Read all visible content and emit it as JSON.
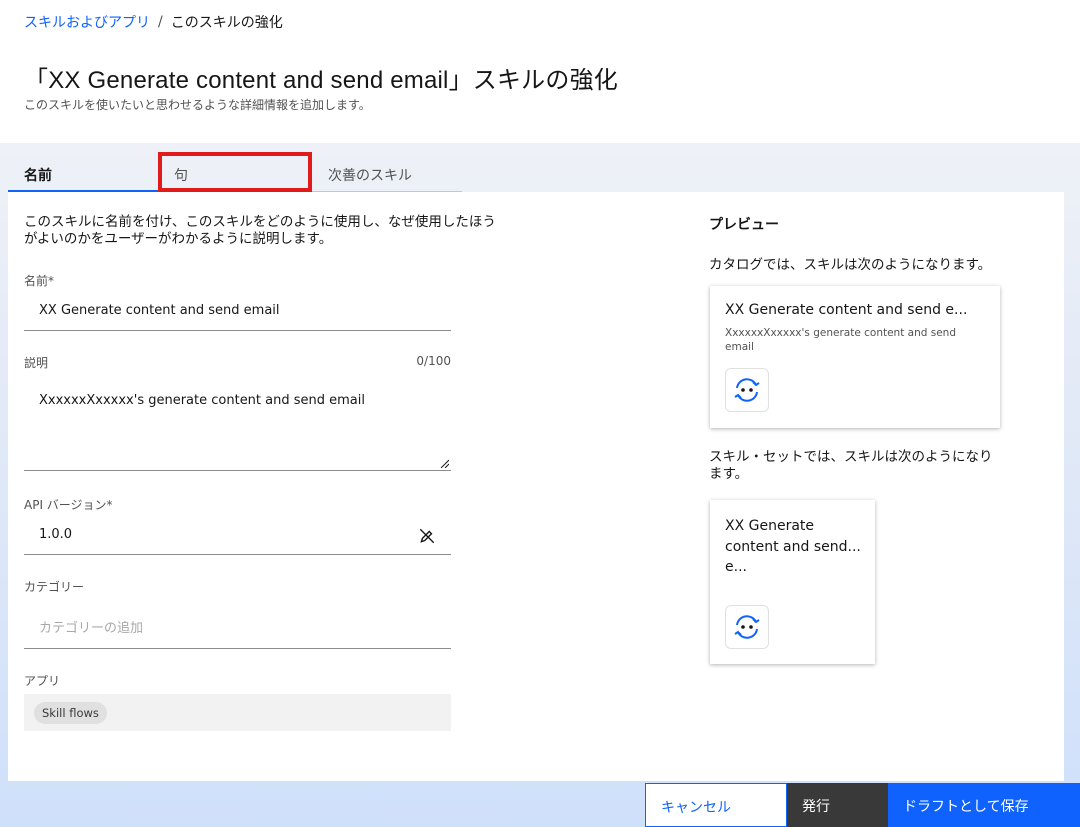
{
  "breadcrumb": {
    "link": "スキルおよびアプリ",
    "separator": "/",
    "current": "このスキルの強化"
  },
  "page": {
    "title": "「XX Generate content and send email」スキルの強化",
    "subtitle": "このスキルを使いたいと思わせるような詳細情報を追加します。"
  },
  "tabs": [
    {
      "label": "名前",
      "active": true
    },
    {
      "label": "句",
      "active": false
    },
    {
      "label": "次善のスキル",
      "active": false
    }
  ],
  "form": {
    "intro": "このスキルに名前を付け、このスキルをどのように使用し、なぜ使用したほうがよいのかをユーザーがわかるように説明します。",
    "name_label": "名前*",
    "name_value": "XX Generate content and send email",
    "description_label": "説明",
    "description_counter": "0/100",
    "description_value": "XxxxxxXxxxxx's generate content and send email",
    "api_version_label": "API バージョン*",
    "api_version_value": "1.0.0",
    "category_label": "カテゴリー",
    "category_placeholder": "カテゴリーの追加",
    "apps_label": "アプリ",
    "apps_tags": [
      "Skill flows"
    ]
  },
  "preview": {
    "title": "プレビュー",
    "catalog_label": "カタログでは、スキルは次のようになります。",
    "catalog_card_title": "XX Generate content and send e...",
    "catalog_card_desc": "XxxxxxXxxxxx's generate content and send email",
    "skillset_label": "スキル・セットでは、スキルは次のようになります。",
    "skillset_card_title": "XX Generate content and send... e..."
  },
  "footer": {
    "cancel": "キャンセル",
    "publish": "発行",
    "save_draft": "ドラフトとして保存"
  },
  "colors": {
    "accent": "#0f62fe",
    "highlight": "#e01b1b",
    "dark_button": "#393939"
  }
}
